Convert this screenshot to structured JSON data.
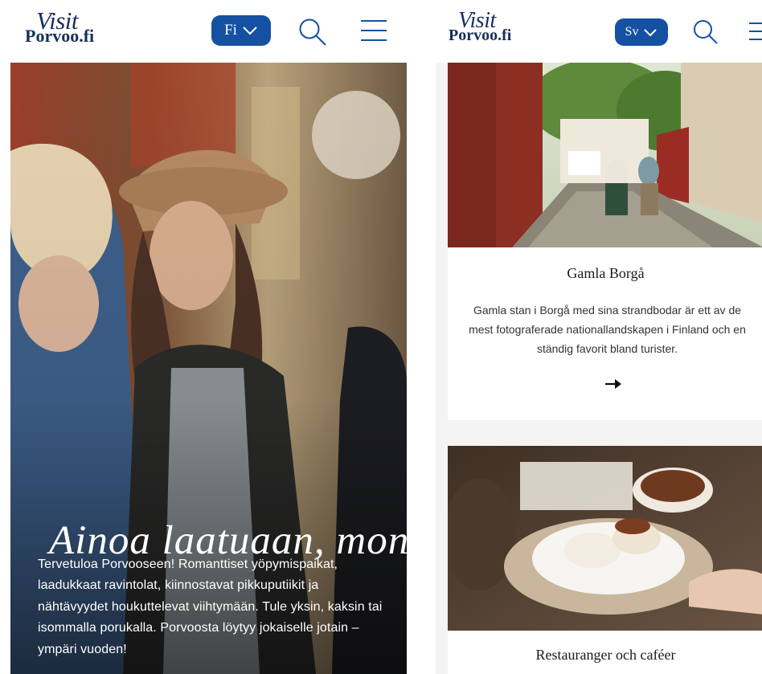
{
  "left_screen": {
    "logo": {
      "line1": "Visit",
      "line2": "Porvoo.fi"
    },
    "language": {
      "selected": "Fi"
    },
    "icons": {
      "search": "search-icon",
      "menu": "hamburger-menu-icon",
      "language": "chevron-down-icon"
    },
    "hero": {
      "title": "Ainoa laatuaan, mon",
      "text": "Tervetuloa Porvooseen! Romanttiset yöpymispaikat, laadukkaat ravintolat, kiinnostavat pikkuputiikit ja nähtävyydet houkuttelevat viihtymään. Tule yksin, kaksin tai isommalla porukalla. Porvoosta löytyy jokaiselle jotain – ympäri vuoden!"
    }
  },
  "right_screen": {
    "logo": {
      "line1": "Visit",
      "line2": "Porvoo.fi"
    },
    "language": {
      "selected": "Sv"
    },
    "icons": {
      "search": "search-icon",
      "menu": "hamburger-menu-icon",
      "arrow": "arrow-right-icon"
    },
    "cards": [
      {
        "title": "Gamla Borgå",
        "text": "Gamla stan i Borgå med sina strandbodar är ett av de mest fotograferade nationallandskapen i Finland och en ständig favorit bland turister.",
        "arrow": "→"
      },
      {
        "title": "Restauranger och caféer"
      }
    ]
  },
  "colors": {
    "brand_navy": "#16305c",
    "accent_blue": "#1551a3",
    "card_background": "#ffffff",
    "page_background": "#f4f4f4"
  }
}
